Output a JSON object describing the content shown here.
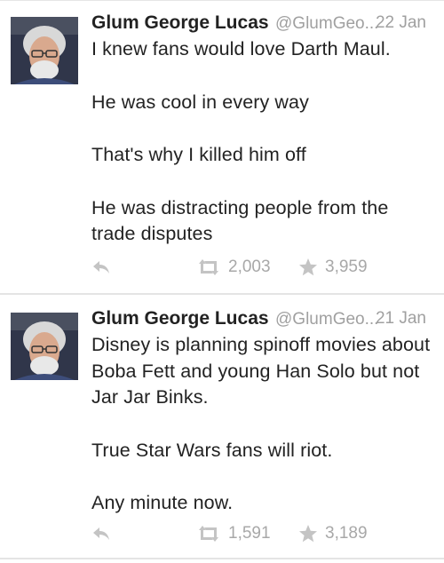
{
  "colors": {
    "name": "#222222",
    "meta": "#a0a0a0",
    "icon": "#c4c4c4",
    "divider": "#e4e4e4"
  },
  "tweets": [
    {
      "author": {
        "name": "Glum George Lucas",
        "handle": "@GlumGeo...",
        "avatar_icon": "avatar-portrait"
      },
      "time": "22 Jan",
      "paragraphs": [
        "I knew fans would love Darth Maul.",
        "He was cool in every way",
        "That's why I killed him off",
        "He was distracting people from the trade disputes"
      ],
      "actions": {
        "reply_icon": "reply-icon",
        "retweet_icon": "retweet-icon",
        "retweets": "2,003",
        "favorite_icon": "star-icon",
        "favorites": "3,959"
      }
    },
    {
      "author": {
        "name": "Glum George Lucas",
        "handle": "@GlumGeo...",
        "avatar_icon": "avatar-portrait"
      },
      "time": "21 Jan",
      "paragraphs": [
        "Disney is planning spinoff movies about Boba Fett and young Han Solo but not Jar Jar Binks.",
        "True Star Wars fans will riot.",
        "Any minute now."
      ],
      "actions": {
        "reply_icon": "reply-icon",
        "retweet_icon": "retweet-icon",
        "retweets": "1,591",
        "favorite_icon": "star-icon",
        "favorites": "3,189"
      }
    }
  ]
}
